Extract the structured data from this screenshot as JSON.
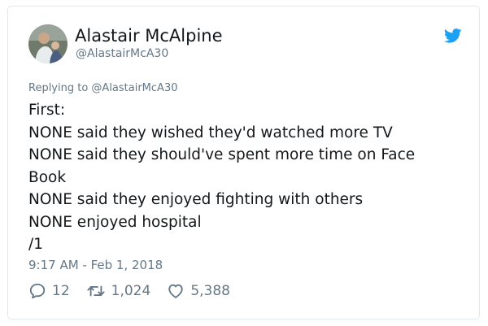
{
  "tweet": {
    "author_name": "Alastair McAlpine",
    "author_handle": "@AlastairMcA30",
    "reply_context": "Replying to @AlastairMcA30",
    "lines": [
      "First:",
      "NONE said they wished they'd watched more TV",
      "NONE said they should've spent more time on Face",
      "Book",
      "NONE said they enjoyed fighting with others",
      "NONE enjoyed hospital",
      "/1"
    ],
    "timestamp": "9:17 AM - Feb 1, 2018",
    "replies": "12",
    "retweets": "1,024",
    "likes": "5,388"
  },
  "icons": {
    "brand": "twitter-bird-icon",
    "reply": "reply-icon",
    "retweet": "retweet-icon",
    "like": "heart-icon"
  },
  "colors": {
    "brand": "#1da1f2",
    "secondary_text": "#657786",
    "primary_text": "#14171a",
    "border": "#e1e8ed"
  }
}
